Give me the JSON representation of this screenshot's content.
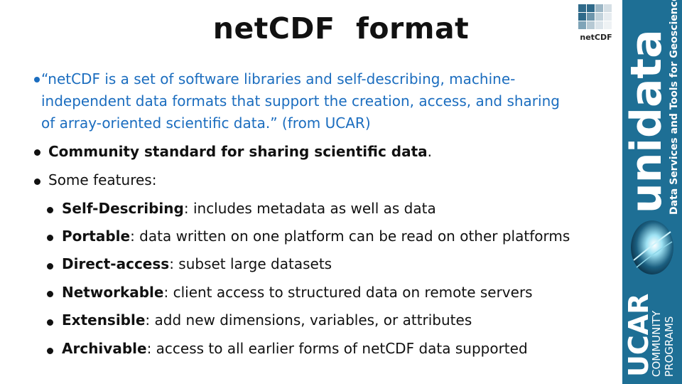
{
  "slide": {
    "title": "netCDF  format",
    "quote": "“netCDF is a set of software libraries and self-describing, machine-\nindependent data formats that support the creation, access, and sharing\nof array-oriented scientific data.” (from UCAR)",
    "community_bold": "Community standard for sharing scientific data",
    "community_tail": ".",
    "features_intro": "Some features:",
    "features": [
      {
        "term": "Self-Describing",
        "desc": ": includes metadata as well as data"
      },
      {
        "term": "Portable",
        "desc": ": data written on one platform can be read on other platforms"
      },
      {
        "term": "Direct-access",
        "desc": ": subset large datasets"
      },
      {
        "term": "Networkable",
        "desc": ": client access to structured data on remote servers"
      },
      {
        "term": "Extensible",
        "desc": ": add new dimensions, variables, or attributes"
      },
      {
        "term": "Archivable",
        "desc": ": access to all earlier forms of netCDF data supported"
      }
    ]
  },
  "logo": {
    "text": "netCDF",
    "grid_colors": [
      "#3a6f8c",
      "#7fa4b8",
      "#c9d6de",
      "#e6ecf0"
    ]
  },
  "banner": {
    "unidata": "unidata",
    "tagline": "Data Services and Tools for Geoscience",
    "ucar": "UCAR",
    "community": "COMMUNITY",
    "programs": "PROGRAMS",
    "color": "#1e6f95"
  },
  "colors": {
    "quote_text": "#1b6dbf",
    "body_text": "#111111"
  }
}
